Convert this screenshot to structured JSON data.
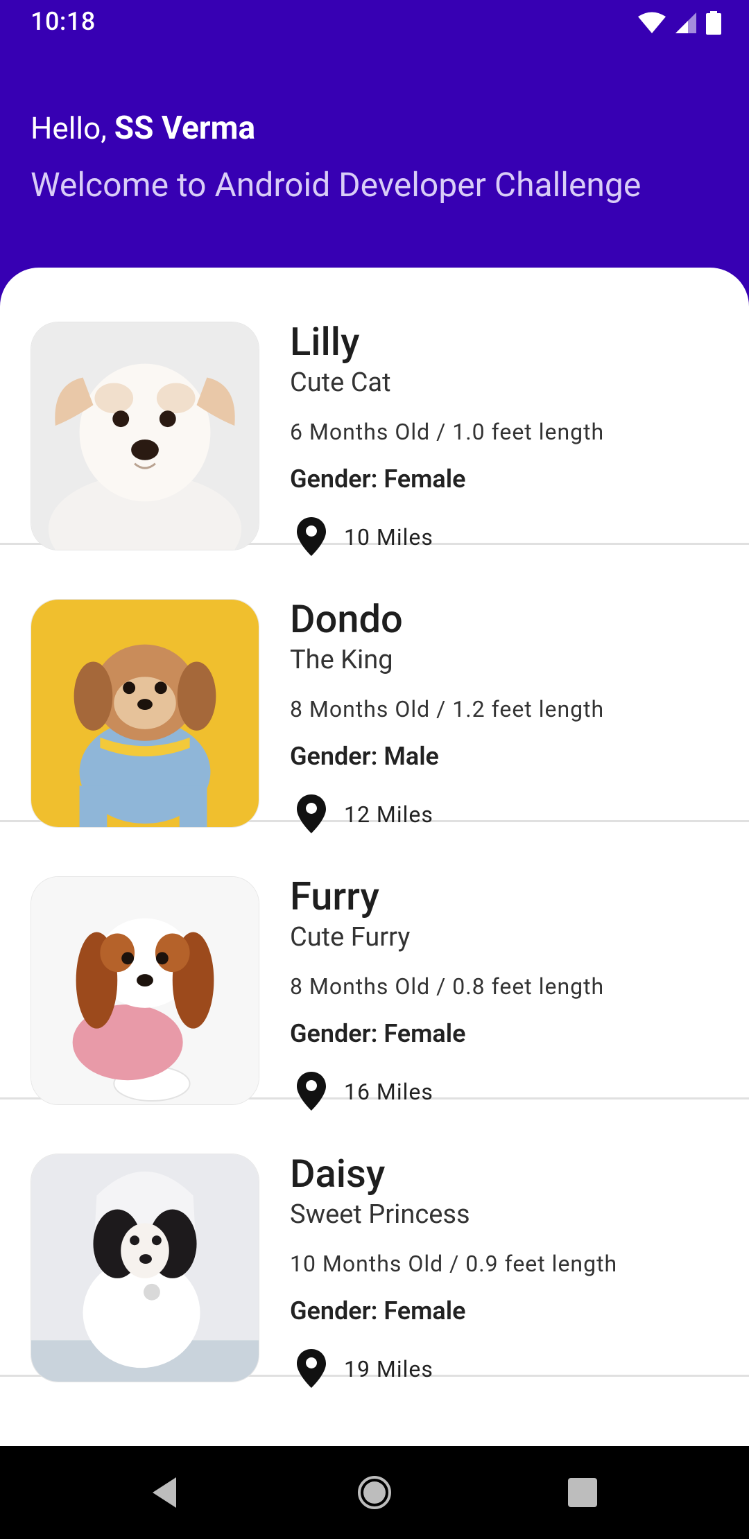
{
  "status_bar": {
    "time": "10:18"
  },
  "header": {
    "hello": "Hello,",
    "user_name": "SS Verma",
    "welcome": "Welcome to Android Developer Challenge"
  },
  "pets": [
    {
      "name": "Lilly",
      "subtitle": "Cute Cat",
      "age_length": "6 Months Old / 1.0 feet length",
      "gender": "Gender: Female",
      "distance": "10 Miles"
    },
    {
      "name": "Dondo",
      "subtitle": "The King",
      "age_length": "8 Months Old / 1.2 feet length",
      "gender": "Gender: Male",
      "distance": "12 Miles"
    },
    {
      "name": "Furry",
      "subtitle": "Cute Furry",
      "age_length": "8 Months Old / 0.8 feet length",
      "gender": "Gender: Female",
      "distance": "16 Miles"
    },
    {
      "name": "Daisy",
      "subtitle": "Sweet Princess",
      "age_length": "10 Months Old / 0.9 feet length",
      "gender": "Gender: Female",
      "distance": "19 Miles"
    }
  ],
  "colors": {
    "primary": "#3700b3",
    "welcome_text": "#d9cdf7"
  },
  "icons": {
    "location": "location-pin-icon",
    "back": "back-triangle-icon",
    "home": "home-circle-icon",
    "recents": "recents-square-icon"
  }
}
